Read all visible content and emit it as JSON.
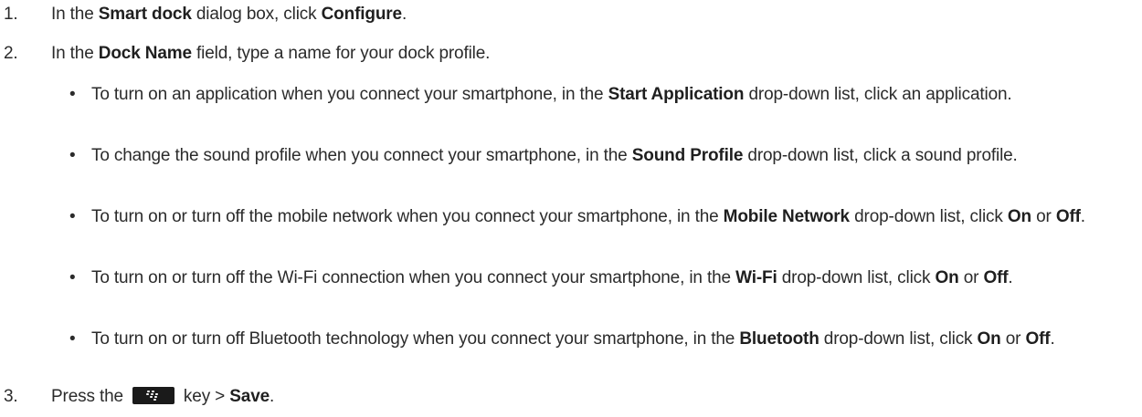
{
  "steps": [
    {
      "num": "1.",
      "parts": [
        {
          "t": "In the "
        },
        {
          "t": "Smart dock",
          "b": true
        },
        {
          "t": " dialog box, click "
        },
        {
          "t": "Configure",
          "b": true
        },
        {
          "t": "."
        }
      ]
    },
    {
      "num": "2.",
      "parts": [
        {
          "t": "In the "
        },
        {
          "t": "Dock Name",
          "b": true
        },
        {
          "t": " field, type a name for your dock profile."
        }
      ]
    },
    {
      "num": "3.",
      "before_key": "Press the",
      "key_icon": "blackberry-menu-key-icon",
      "after_key": "key > ",
      "save": "Save",
      "end": "."
    }
  ],
  "bullet_char": "•",
  "bullets": [
    [
      {
        "t": "To turn on an application when you connect your smartphone, in the "
      },
      {
        "t": "Start Application",
        "b": true
      },
      {
        "t": " drop-down list, click an application."
      }
    ],
    [
      {
        "t": "To change the sound profile when you connect your smartphone, in the "
      },
      {
        "t": "Sound Profile",
        "b": true
      },
      {
        "t": " drop-down list, click a sound profile."
      }
    ],
    [
      {
        "t": "To turn on or turn off the mobile network when you connect your smartphone, in the "
      },
      {
        "t": "Mobile Network",
        "b": true
      },
      {
        "t": " drop-down list, click "
      },
      {
        "t": "On",
        "b": true
      },
      {
        "t": " or "
      },
      {
        "t": "Off",
        "b": true
      },
      {
        "t": "."
      }
    ],
    [
      {
        "t": "To turn on or turn off the Wi-Fi connection when you connect your smartphone, in the "
      },
      {
        "t": "Wi-Fi",
        "b": true
      },
      {
        "t": " drop-down list, click "
      },
      {
        "t": "On",
        "b": true
      },
      {
        "t": " or "
      },
      {
        "t": "Off",
        "b": true
      },
      {
        "t": "."
      }
    ],
    [
      {
        "t": "To turn on or turn off Bluetooth technology when you connect your smartphone, in the "
      },
      {
        "t": "Bluetooth",
        "b": true
      },
      {
        "t": " drop-down list, click "
      },
      {
        "t": "On",
        "b": true
      },
      {
        "t": " or "
      },
      {
        "t": "Off",
        "b": true
      },
      {
        "t": "."
      }
    ]
  ]
}
